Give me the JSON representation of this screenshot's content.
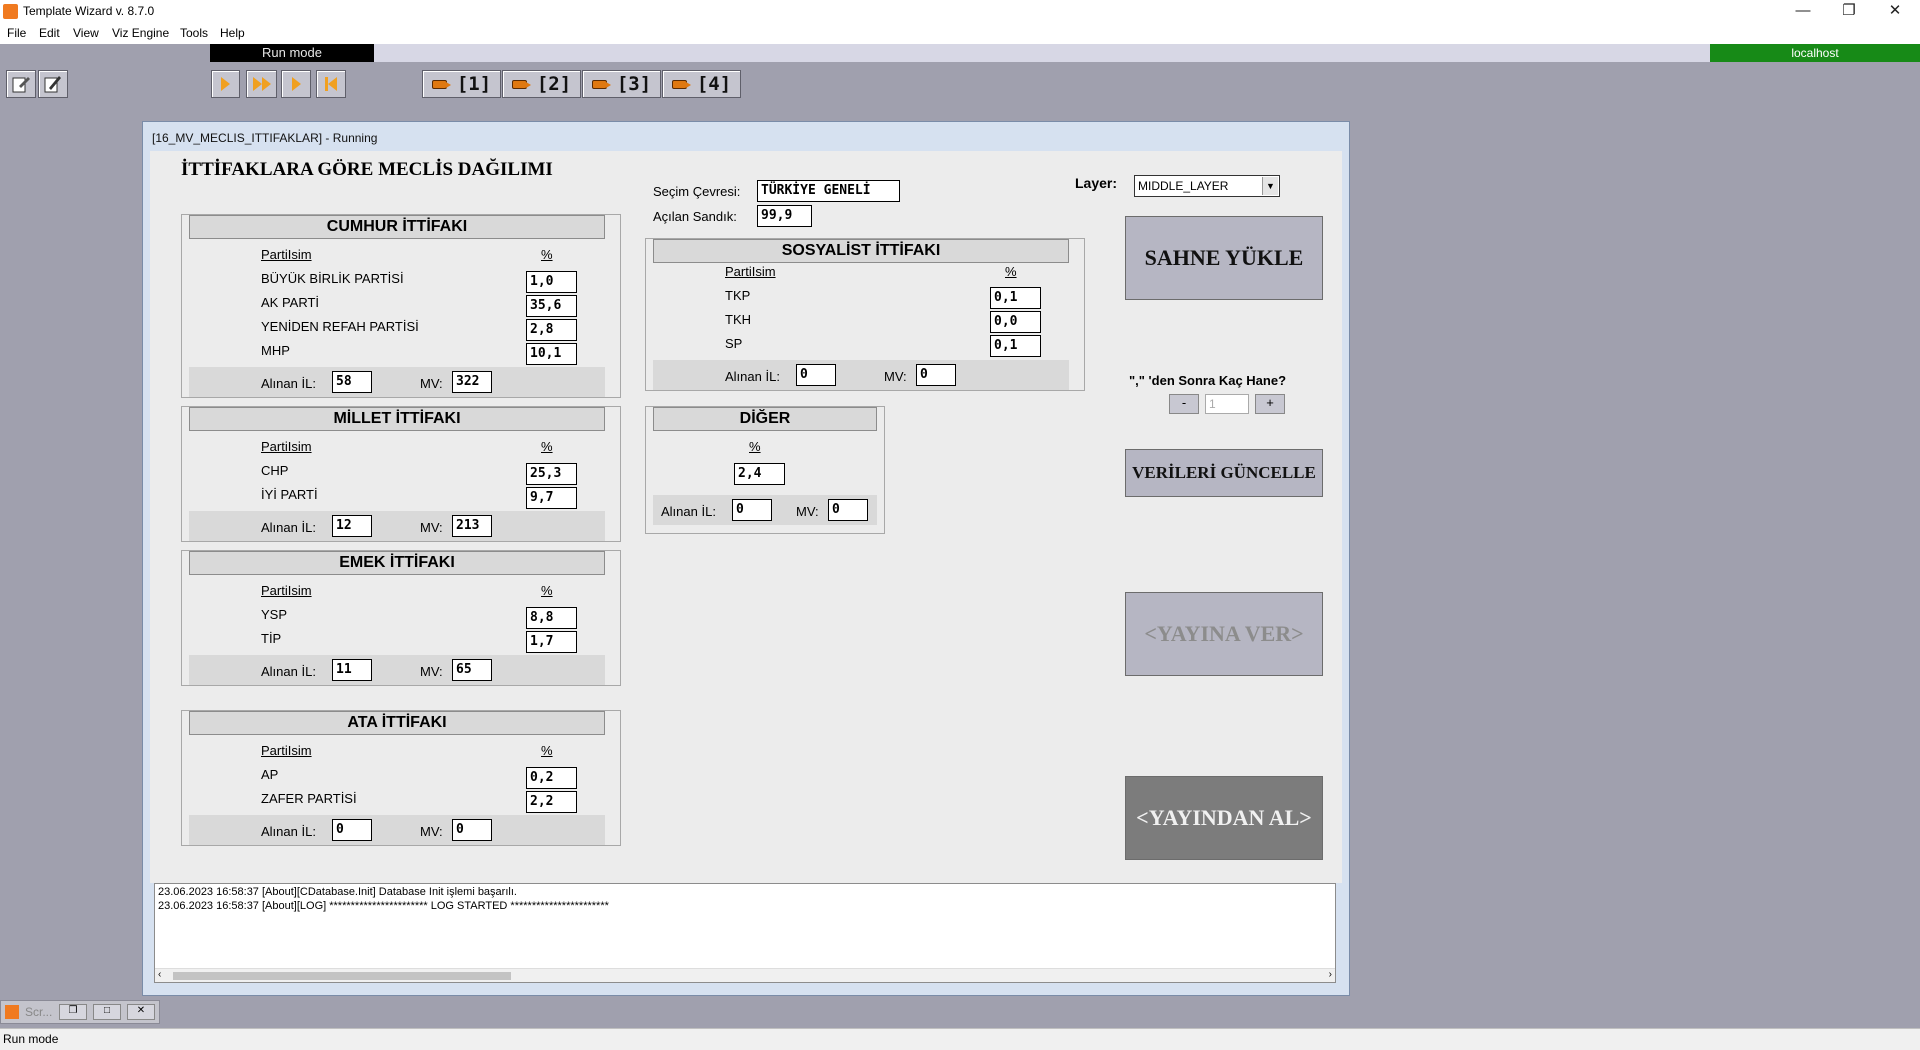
{
  "app": {
    "title": "Template Wizard v. 8.7.0",
    "menu": [
      "File",
      "Edit",
      "View",
      "Viz Engine",
      "Tools",
      "Help"
    ],
    "run_mode": "Run mode",
    "host": "localhost"
  },
  "toolbar": {
    "cams": [
      "[1]",
      "[2]",
      "[3]",
      "[4]"
    ]
  },
  "window": {
    "title": "[16_MV_MECLIS_ITTIFAKLAR] - Running"
  },
  "form": {
    "heading": "İTTİFAKLARA GÖRE MECLİS DAĞILIMI",
    "secim_label": "Seçim Çevresi:",
    "secim_value": "TÜRKİYE GENELİ",
    "sandik_label": "Açılan Sandık:",
    "sandik_value": "99,9",
    "layer_label": "Layer:",
    "layer_value": "MIDDLE_LAYER",
    "col_party": "PartiIsim",
    "col_pct": "%",
    "il_label": "Alınan İL:",
    "mv_label": "MV:",
    "cumhur": {
      "title": "CUMHUR İTTİFAKI",
      "rows": [
        [
          "BÜYÜK BİRLİK PARTİSİ",
          "1,0"
        ],
        [
          "AK PARTİ",
          "35,6"
        ],
        [
          "YENİDEN REFAH PARTİSİ",
          "2,8"
        ],
        [
          "MHP",
          "10,1"
        ]
      ],
      "il": "58",
      "mv": "322"
    },
    "millet": {
      "title": "MİLLET İTTİFAKI",
      "rows": [
        [
          "CHP",
          "25,3"
        ],
        [
          "İYİ PARTİ",
          "9,7"
        ]
      ],
      "il": "12",
      "mv": "213"
    },
    "emek": {
      "title": "EMEK İTTİFAKI",
      "rows": [
        [
          "YSP",
          "8,8"
        ],
        [
          "TİP",
          "1,7"
        ]
      ],
      "il": "11",
      "mv": "65"
    },
    "ata": {
      "title": "ATA İTTİFAKI",
      "rows": [
        [
          "AP",
          "0,2"
        ],
        [
          "ZAFER PARTİSİ",
          "2,2"
        ]
      ],
      "il": "0",
      "mv": "0"
    },
    "sosyalist": {
      "title": "SOSYALİST İTTİFAKI",
      "rows": [
        [
          "TKP",
          "0,1"
        ],
        [
          "TKH",
          "0,0"
        ],
        [
          "SP",
          "0,1"
        ]
      ],
      "il": "0",
      "mv": "0"
    },
    "diger": {
      "title": "DİĞER",
      "pct": "2,4",
      "il": "0",
      "mv": "0"
    },
    "btn_sahne": "SAHNE YÜKLE",
    "decimals_label": "\",\" 'den Sonra Kaç Hane?",
    "dec_minus": "-",
    "dec_value": "1",
    "dec_plus": "+",
    "btn_guncelle": "VERİLERİ GÜNCELLE",
    "btn_yayina": "<YAYINA VER>",
    "btn_yayindan": "<YAYINDAN AL>"
  },
  "log": [
    "23.06.2023 16:58:37 [About][CDatabase.Init] Database Init işlemi başarılı.",
    "23.06.2023 16:58:37 [About][LOG] *********************** LOG STARTED ***********************"
  ],
  "mdi": {
    "label": "Scr..."
  },
  "status": {
    "text": "Run mode"
  }
}
